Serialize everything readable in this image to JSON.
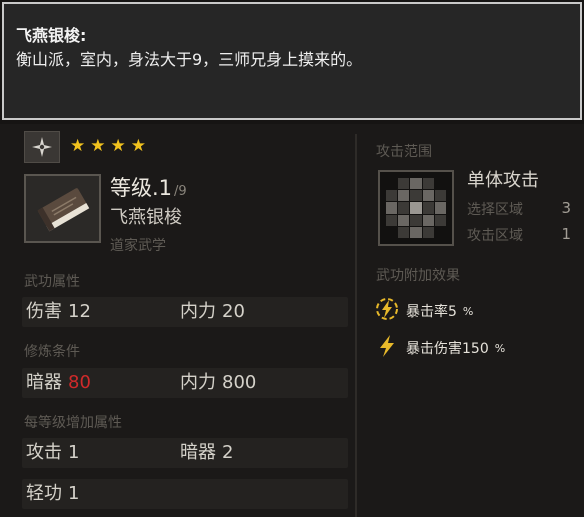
{
  "tooltip": {
    "title": "飞燕银梭:",
    "description": "衡山派，室内，身法大于9，三师兄身上摸来的。"
  },
  "item": {
    "stars": [
      "★",
      "★",
      "★",
      "★"
    ],
    "level": "等级.1",
    "level_max": "/9",
    "name": "飞燕银梭",
    "school": "道家武学"
  },
  "sections": {
    "attributes": "武功属性",
    "requirements": "修炼条件",
    "per_level": "每等级增加属性",
    "attack_range": "攻击范围",
    "bonus_effects": "武功附加效果"
  },
  "attributes": {
    "damage_label": "伤害",
    "damage_value": "12",
    "internal_label": "内力",
    "internal_value": "20"
  },
  "requirements": {
    "hidden_weapon_label": "暗器",
    "hidden_weapon_value": "80",
    "internal_label": "内力",
    "internal_value": "800"
  },
  "per_level": {
    "attack_label": "攻击",
    "attack_value": "1",
    "hidden_weapon_label": "暗器",
    "hidden_weapon_value": "2",
    "lightness_label": "轻功",
    "lightness_value": "1"
  },
  "range": {
    "type": "单体攻击",
    "select_label": "选择区域",
    "select_value": "3",
    "attack_label": "攻击区域",
    "attack_value": "1"
  },
  "effects": [
    {
      "label": "暴击率5",
      "pct": "%",
      "icon": "lightning-circle-icon"
    },
    {
      "label": "暴击伤害150",
      "pct": "%",
      "icon": "lightning-icon"
    }
  ],
  "colors": {
    "star": "#f1c21e",
    "requirement_unmet": "#cf2a2a",
    "effect_icon": "#e8b92a"
  }
}
